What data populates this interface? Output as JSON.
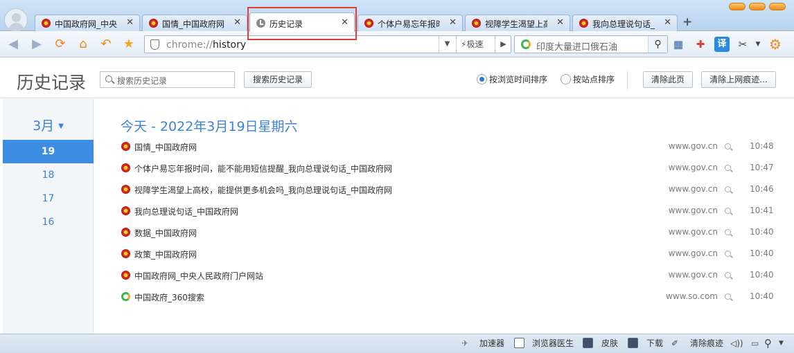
{
  "tabs": [
    {
      "label": "中国政府网_中央",
      "icon": "gov-emblem-icon"
    },
    {
      "label": "国情_中国政府网",
      "icon": "gov-emblem-icon"
    },
    {
      "label": "历史记录",
      "icon": "clock-icon",
      "active": true
    },
    {
      "label": "个体户易忘年报时",
      "icon": "gov-emblem-icon"
    },
    {
      "label": "视障学生渴望上高",
      "icon": "gov-emblem-icon"
    },
    {
      "label": "我向总理说句话_",
      "icon": "gov-emblem-icon"
    }
  ],
  "toolbar": {
    "address_prefix": "chrome://",
    "address_path": "history",
    "speed_label": "极速",
    "search_placeholder": "印度大量进口俄石油",
    "translate_label": "译"
  },
  "history_page": {
    "title": "历史记录",
    "search_placeholder": "搜索历史记录",
    "search_button": "搜索历史记录",
    "sort_by_time": "按浏览时间排序",
    "sort_by_site": "按站点排序",
    "sort_selected": "time",
    "clear_page_button": "清除此页",
    "clear_traces_button": "清除上网痕迹..."
  },
  "sidebar": {
    "month": "3月",
    "days": [
      "19",
      "18",
      "17",
      "16"
    ],
    "active_day": "19"
  },
  "day_heading": "今天 - 2022年3月19日星期六",
  "entries": [
    {
      "title": "国情_中国政府网",
      "domain": "www.gov.cn",
      "time": "10:48",
      "icon": "gov-emblem-icon"
    },
    {
      "title": "个体户易忘年报时间，能不能用短信提醒_我向总理说句话_中国政府网",
      "domain": "www.gov.cn",
      "time": "10:47",
      "icon": "gov-emblem-icon"
    },
    {
      "title": "视障学生渴望上高校，能提供更多机会吗_我向总理说句话_中国政府网",
      "domain": "www.gov.cn",
      "time": "10:46",
      "icon": "gov-emblem-icon"
    },
    {
      "title": "我向总理说句话_中国政府网",
      "domain": "www.gov.cn",
      "time": "10:41",
      "icon": "gov-emblem-icon"
    },
    {
      "title": "数据_中国政府网",
      "domain": "www.gov.cn",
      "time": "10:40",
      "icon": "gov-emblem-icon"
    },
    {
      "title": "政策_中国政府网",
      "domain": "www.gov.cn",
      "time": "10:40",
      "icon": "gov-emblem-icon"
    },
    {
      "title": "中国政府网_中央人民政府门户网站",
      "domain": "www.gov.cn",
      "time": "10:40",
      "icon": "gov-emblem-icon"
    },
    {
      "title": "中国政府_360搜索",
      "domain": "www.so.com",
      "time": "10:40",
      "icon": "so360-icon"
    }
  ],
  "statusbar": {
    "accelerator": "加速器",
    "doctor": "浏览器医生",
    "skin": "皮肤",
    "download": "下载",
    "clear_traces": "清除痕迹"
  },
  "colors": {
    "accent_blue": "#3b82d8",
    "active_day_bg": "#3d8ee3",
    "highlight_box": "#e53935"
  }
}
